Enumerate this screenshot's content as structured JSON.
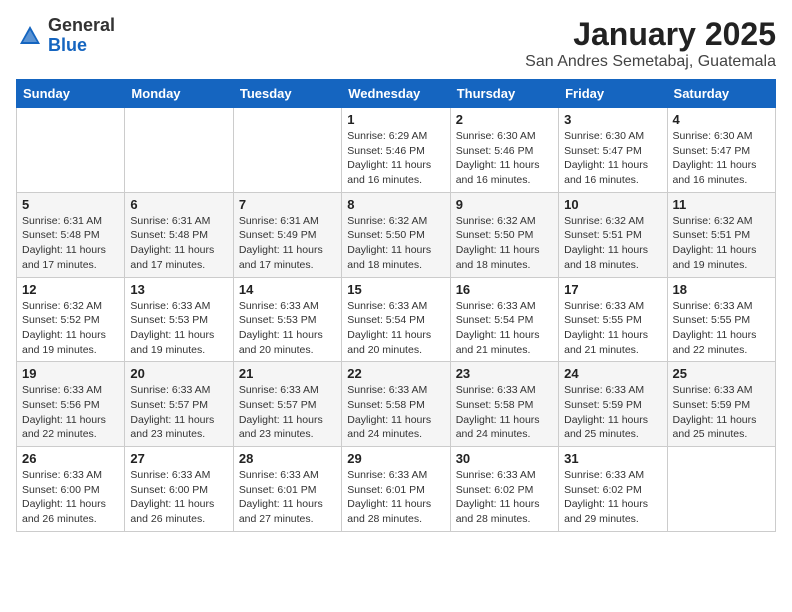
{
  "logo": {
    "general": "General",
    "blue": "Blue"
  },
  "header": {
    "month": "January 2025",
    "location": "San Andres Semetabaj, Guatemala"
  },
  "days_of_week": [
    "Sunday",
    "Monday",
    "Tuesday",
    "Wednesday",
    "Thursday",
    "Friday",
    "Saturday"
  ],
  "weeks": [
    [
      {
        "day": "",
        "info": ""
      },
      {
        "day": "",
        "info": ""
      },
      {
        "day": "",
        "info": ""
      },
      {
        "day": "1",
        "info": "Sunrise: 6:29 AM\nSunset: 5:46 PM\nDaylight: 11 hours and 16 minutes."
      },
      {
        "day": "2",
        "info": "Sunrise: 6:30 AM\nSunset: 5:46 PM\nDaylight: 11 hours and 16 minutes."
      },
      {
        "day": "3",
        "info": "Sunrise: 6:30 AM\nSunset: 5:47 PM\nDaylight: 11 hours and 16 minutes."
      },
      {
        "day": "4",
        "info": "Sunrise: 6:30 AM\nSunset: 5:47 PM\nDaylight: 11 hours and 16 minutes."
      }
    ],
    [
      {
        "day": "5",
        "info": "Sunrise: 6:31 AM\nSunset: 5:48 PM\nDaylight: 11 hours and 17 minutes."
      },
      {
        "day": "6",
        "info": "Sunrise: 6:31 AM\nSunset: 5:48 PM\nDaylight: 11 hours and 17 minutes."
      },
      {
        "day": "7",
        "info": "Sunrise: 6:31 AM\nSunset: 5:49 PM\nDaylight: 11 hours and 17 minutes."
      },
      {
        "day": "8",
        "info": "Sunrise: 6:32 AM\nSunset: 5:50 PM\nDaylight: 11 hours and 18 minutes."
      },
      {
        "day": "9",
        "info": "Sunrise: 6:32 AM\nSunset: 5:50 PM\nDaylight: 11 hours and 18 minutes."
      },
      {
        "day": "10",
        "info": "Sunrise: 6:32 AM\nSunset: 5:51 PM\nDaylight: 11 hours and 18 minutes."
      },
      {
        "day": "11",
        "info": "Sunrise: 6:32 AM\nSunset: 5:51 PM\nDaylight: 11 hours and 19 minutes."
      }
    ],
    [
      {
        "day": "12",
        "info": "Sunrise: 6:32 AM\nSunset: 5:52 PM\nDaylight: 11 hours and 19 minutes."
      },
      {
        "day": "13",
        "info": "Sunrise: 6:33 AM\nSunset: 5:53 PM\nDaylight: 11 hours and 19 minutes."
      },
      {
        "day": "14",
        "info": "Sunrise: 6:33 AM\nSunset: 5:53 PM\nDaylight: 11 hours and 20 minutes."
      },
      {
        "day": "15",
        "info": "Sunrise: 6:33 AM\nSunset: 5:54 PM\nDaylight: 11 hours and 20 minutes."
      },
      {
        "day": "16",
        "info": "Sunrise: 6:33 AM\nSunset: 5:54 PM\nDaylight: 11 hours and 21 minutes."
      },
      {
        "day": "17",
        "info": "Sunrise: 6:33 AM\nSunset: 5:55 PM\nDaylight: 11 hours and 21 minutes."
      },
      {
        "day": "18",
        "info": "Sunrise: 6:33 AM\nSunset: 5:55 PM\nDaylight: 11 hours and 22 minutes."
      }
    ],
    [
      {
        "day": "19",
        "info": "Sunrise: 6:33 AM\nSunset: 5:56 PM\nDaylight: 11 hours and 22 minutes."
      },
      {
        "day": "20",
        "info": "Sunrise: 6:33 AM\nSunset: 5:57 PM\nDaylight: 11 hours and 23 minutes."
      },
      {
        "day": "21",
        "info": "Sunrise: 6:33 AM\nSunset: 5:57 PM\nDaylight: 11 hours and 23 minutes."
      },
      {
        "day": "22",
        "info": "Sunrise: 6:33 AM\nSunset: 5:58 PM\nDaylight: 11 hours and 24 minutes."
      },
      {
        "day": "23",
        "info": "Sunrise: 6:33 AM\nSunset: 5:58 PM\nDaylight: 11 hours and 24 minutes."
      },
      {
        "day": "24",
        "info": "Sunrise: 6:33 AM\nSunset: 5:59 PM\nDaylight: 11 hours and 25 minutes."
      },
      {
        "day": "25",
        "info": "Sunrise: 6:33 AM\nSunset: 5:59 PM\nDaylight: 11 hours and 25 minutes."
      }
    ],
    [
      {
        "day": "26",
        "info": "Sunrise: 6:33 AM\nSunset: 6:00 PM\nDaylight: 11 hours and 26 minutes."
      },
      {
        "day": "27",
        "info": "Sunrise: 6:33 AM\nSunset: 6:00 PM\nDaylight: 11 hours and 26 minutes."
      },
      {
        "day": "28",
        "info": "Sunrise: 6:33 AM\nSunset: 6:01 PM\nDaylight: 11 hours and 27 minutes."
      },
      {
        "day": "29",
        "info": "Sunrise: 6:33 AM\nSunset: 6:01 PM\nDaylight: 11 hours and 28 minutes."
      },
      {
        "day": "30",
        "info": "Sunrise: 6:33 AM\nSunset: 6:02 PM\nDaylight: 11 hours and 28 minutes."
      },
      {
        "day": "31",
        "info": "Sunrise: 6:33 AM\nSunset: 6:02 PM\nDaylight: 11 hours and 29 minutes."
      },
      {
        "day": "",
        "info": ""
      }
    ]
  ]
}
